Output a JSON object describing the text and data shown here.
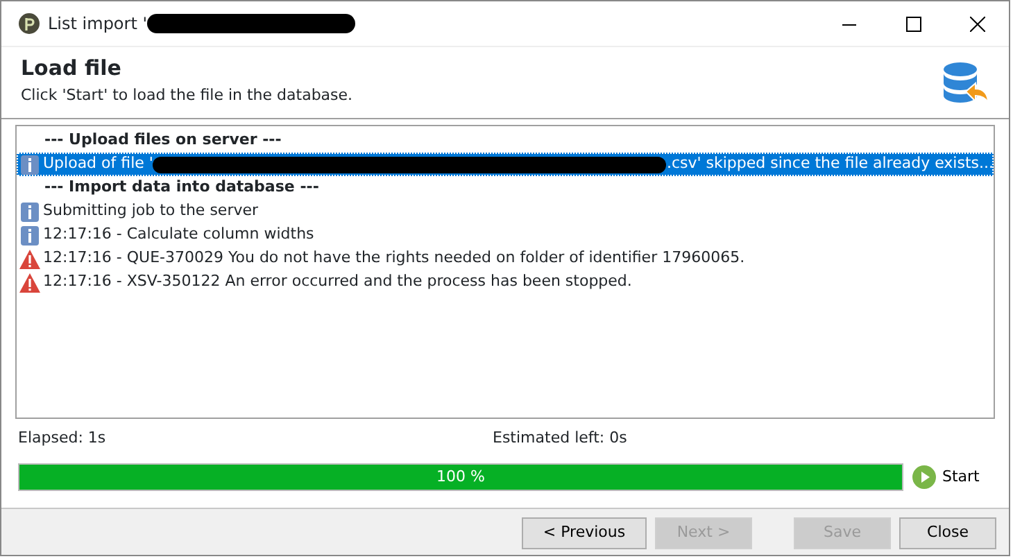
{
  "window": {
    "title": "List import '",
    "title_redacted": true
  },
  "header": {
    "title": "Load file",
    "subtitle": "Click 'Start' to load the file in the database."
  },
  "log": [
    {
      "kind": "header",
      "text": "--- Upload files on server ---",
      "selected": false
    },
    {
      "kind": "info",
      "text": "Upload of file '",
      "text_after_redaction": ".csv' skipped since the file already exists...",
      "selected": true
    },
    {
      "kind": "header",
      "text": "--- Import data into database ---",
      "selected": false
    },
    {
      "kind": "info",
      "text": "Submitting job to the server",
      "selected": false
    },
    {
      "kind": "info",
      "text": "12:17:16 - Calculate column widths",
      "selected": false
    },
    {
      "kind": "error",
      "text": "12:17:16 - QUE-370029 You do not have the rights needed on folder of identifier 17960065.",
      "selected": false
    },
    {
      "kind": "error",
      "text": "12:17:16 - XSV-350122 An error occurred and the process has been stopped.",
      "selected": false
    }
  ],
  "elapsed": {
    "label": "Elapsed:",
    "value": "1s"
  },
  "estimated": {
    "label": "Estimated left:",
    "value": "0s"
  },
  "progress": {
    "level": 1,
    "reading": "100 %"
  },
  "start_button": {
    "label": "Start"
  },
  "buttons": [
    {
      "label": "< Previous",
      "disabled": false
    },
    {
      "label": "Next >",
      "disabled": true
    },
    {
      "label": "Save",
      "disabled": true
    },
    {
      "label": "Close",
      "disabled": false
    }
  ]
}
